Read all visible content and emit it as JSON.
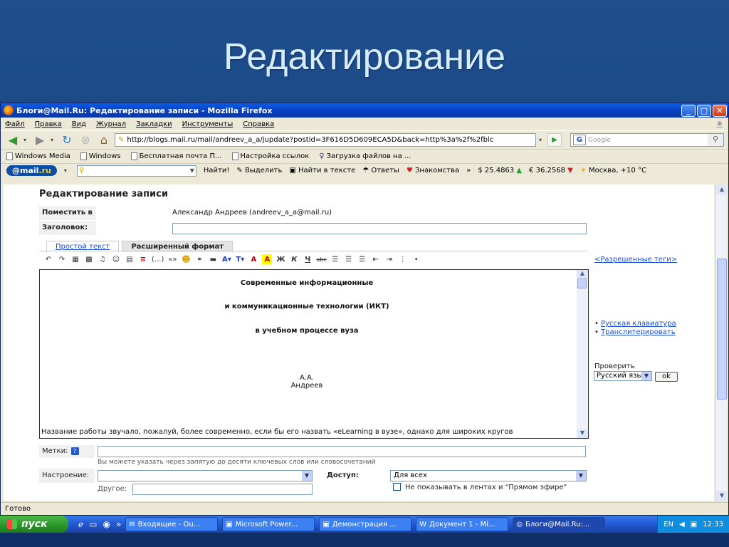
{
  "slide": {
    "title": "Редактирование"
  },
  "window": {
    "title": "Блоги@Mail.Ru: Редактирование записи - Mozilla Firefox",
    "buttons": {
      "minimize": "_",
      "maximize": "□",
      "close": "✕"
    }
  },
  "menu": [
    "Файл",
    "Правка",
    "Вид",
    "Журнал",
    "Закладки",
    "Инструменты",
    "Справка"
  ],
  "nav": {
    "url": "http://blogs.mail.ru/mail/andreev_a_a/jupdate?postid=3F616D5D609ECA5D&back=http%3a%2f%2fblc",
    "search_placeholder": "Google"
  },
  "bookmarks": [
    "Windows Media",
    "Windows",
    "Бесплатная почта П...",
    "Настройка ссылок",
    "Загрузка файлов на ..."
  ],
  "mailbar": {
    "logo_at": "@mail",
    "logo_ru": ".ru",
    "find": "Найти!",
    "highlight": "Выделить",
    "find_in_text": "Найти в тексте",
    "answers": "Ответы",
    "dating": "Знакомства",
    "more": "»",
    "usd": "$ 25.4863",
    "eur": "€ 36.2568",
    "weather": "Москва, +10 °C"
  },
  "form": {
    "heading": "Редактирование записи",
    "place_label": "Поместить в",
    "place_value": "Александр Андреев (andreev_a_a@mail.ru)",
    "title_label": "Заголовок:",
    "tab_plain": "Простой текст",
    "tab_rich": "Расширенный формат",
    "toolbar": {
      "quote": "(...)",
      "quotes": "«»",
      "font": "A▾",
      "size": "T▾",
      "bold": "Ж",
      "italic": "К",
      "underline": "Ч",
      "strike": "abc"
    },
    "editor": {
      "line1": "Современные информационные",
      "line2": "и коммуникационные технологии (ИКТ)",
      "line3": "в учебном процессе вуза",
      "author1": "А.А.",
      "author2": "Андреев",
      "paragraph": "Название работы звучало, пожалуй, более современно, если бы его назвать «eLearning  в вузе», однако для  широких кругов"
    },
    "allowed_tags": "<Разрешенные теги>",
    "rus_keyboard": "Русская клавиатура",
    "transliterate": "Транслитерировать",
    "check_label": "Проверить",
    "check_lang": "Русский язык",
    "ok": "ok",
    "tags_label": "Метки:",
    "tags_help": "?",
    "tags_hint": "Вы можете указать через запятую до десяти ключевых слов или словосочетаний",
    "mood_label": "Настроение:",
    "mood_value": "",
    "other_label": "Другое:",
    "access_label": "Доступ:",
    "access_value": "Для всех",
    "no_feed": "Не показывать в лентах и \"Прямом эфире\""
  },
  "status": "Готово",
  "taskbar": {
    "start": "пуск",
    "tasks": [
      "Входящие - Ou...",
      "Microsoft Power...",
      "Демонстрация ...",
      "Документ 1 - Mi...",
      "Блоги@Mail.Ru:..."
    ],
    "lang": "EN",
    "time": "12:33"
  }
}
